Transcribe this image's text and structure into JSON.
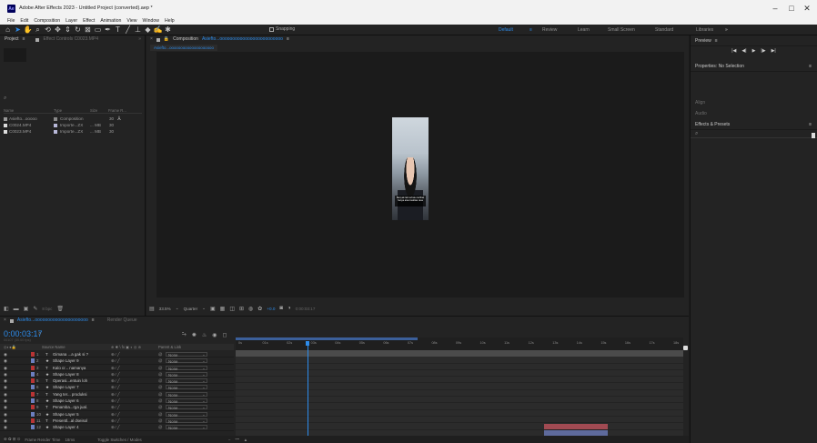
{
  "window": {
    "app_badge": "Ae",
    "title": "Adobe After Effects 2023 - Untitled Project (converted).aep *",
    "controls": [
      "–",
      "□",
      "✕"
    ]
  },
  "menu": [
    "File",
    "Edit",
    "Composition",
    "Layer",
    "Effect",
    "Animation",
    "View",
    "Window",
    "Help"
  ],
  "toolbar": {
    "snapping_label": "Snapping",
    "workspaces": [
      "Default",
      "≡",
      "Review",
      "Learn",
      "Small Screen",
      "Standard",
      "Libraries",
      "»"
    ],
    "active_workspace": "Default"
  },
  "project_panel": {
    "tab_project": "Project",
    "tab_menu": "≡",
    "tab_effect_controls": "Effect Controls C0023.MP4",
    "search_icon": "⌕",
    "columns": [
      "Name",
      "Type",
      "Size",
      "Frame R..."
    ],
    "items": [
      {
        "name": "Asiefto...ooooo",
        "type": "Composition",
        "size": "",
        "rate": "30",
        "color": "#8a8a8a"
      },
      {
        "name": "C0024.MP4",
        "type": "Importe...ZX",
        "size": "... MB",
        "rate": "30",
        "color": "#b8b8d8"
      },
      {
        "name": "C0023.MP4",
        "type": "Importe...ZX",
        "size": "... MB",
        "rate": "30",
        "color": "#b8b8d8"
      }
    ],
    "footer_bpc": "8 bpc"
  },
  "composition_panel": {
    "tab_label": "Composition",
    "comp_name": "Asiefto...ooooooooooooooooooooooooo",
    "tab_menu": "≡",
    "breadcrumb": "Asiefto...oooooooooooooooooooo",
    "caption": "Banyak lab terbatu terlibat hanya atas kualitas rasa",
    "zoom": "33.5%",
    "resolution": "Quarter",
    "timecode": "+0.0",
    "current_time": "0:00:03:17"
  },
  "right_panel": {
    "preview_label": "Preview",
    "preview_menu": "≡",
    "preview_controls": [
      "|◀",
      "◀|",
      "▶",
      "|▶",
      "▶|"
    ],
    "properties_label": "Properties: No Selection",
    "align_label": "Align",
    "audio_label": "Audio",
    "effects_label": "Effects & Presets",
    "effects_search": "⌕"
  },
  "timeline": {
    "tab_label": "Asiefto...ooooooooooooooooooooo",
    "tab_menu": "≡",
    "render_queue": "Render Queue",
    "current_time": "0:00:03:17",
    "frames_info": "00107 (30.00 fps)",
    "search_icon": "⌕",
    "columns": {
      "source_name": "Source Name",
      "switches": "⊕ ✱ \\ fx ▣ ◐ ◎ ⊛",
      "parent": "Parent & Link"
    },
    "ruler": [
      "0s",
      "01s",
      "02s",
      "03s",
      "04s",
      "05s",
      "06s",
      "07s",
      "08s",
      "09s",
      "10s",
      "11s",
      "12s",
      "13s",
      "14s",
      "15s",
      "16s",
      "17s",
      "18s"
    ],
    "layers": [
      {
        "num": "1",
        "type": "T",
        "name": "Gimana ...a gak si ?",
        "parent": "None",
        "color": "#b83434"
      },
      {
        "num": "2",
        "type": "★",
        "name": "Shape Layer 9",
        "parent": "None",
        "color": "#6c7fbf"
      },
      {
        "num": "3",
        "type": "T",
        "name": "Kalo cr... namanya",
        "parent": "None",
        "color": "#b83434"
      },
      {
        "num": "4",
        "type": "★",
        "name": "Shape Layer 8",
        "parent": "None",
        "color": "#6c7fbf"
      },
      {
        "num": "5",
        "type": "T",
        "name": "Operasi...entuin loh",
        "parent": "None",
        "color": "#b83434"
      },
      {
        "num": "6",
        "type": "★",
        "name": "Shape Layer 7",
        "parent": "None",
        "color": "#6c7fbf"
      },
      {
        "num": "7",
        "type": "T",
        "name": "Yang ter... produksi",
        "parent": "None",
        "color": "#b83434"
      },
      {
        "num": "8",
        "type": "★",
        "name": "Shape Layer 6",
        "parent": "None",
        "color": "#6c7fbf"
      },
      {
        "num": "9",
        "type": "T",
        "name": "Penamba...rga jual.",
        "parent": "None",
        "color": "#b83434"
      },
      {
        "num": "10",
        "type": "★",
        "name": "Shape Layer 5",
        "parent": "None",
        "color": "#6c7fbf"
      },
      {
        "num": "11",
        "type": "T",
        "name": "Presentl...al dseisol",
        "parent": "None",
        "color": "#b83434"
      },
      {
        "num": "12",
        "type": "★",
        "name": "Shape Layer 4",
        "parent": "None",
        "color": "#6c7fbf"
      }
    ],
    "footer": {
      "render_time_label": "Frame Render Time",
      "render_time": "18ms",
      "toggle_label": "Toggle Switches / Modes"
    }
  },
  "colors": {
    "accent": "#2d8ceb",
    "panel": "#232323",
    "bg": "#1d1d1d",
    "text_layer": "#b83434",
    "shape_layer": "#6c7fbf"
  }
}
